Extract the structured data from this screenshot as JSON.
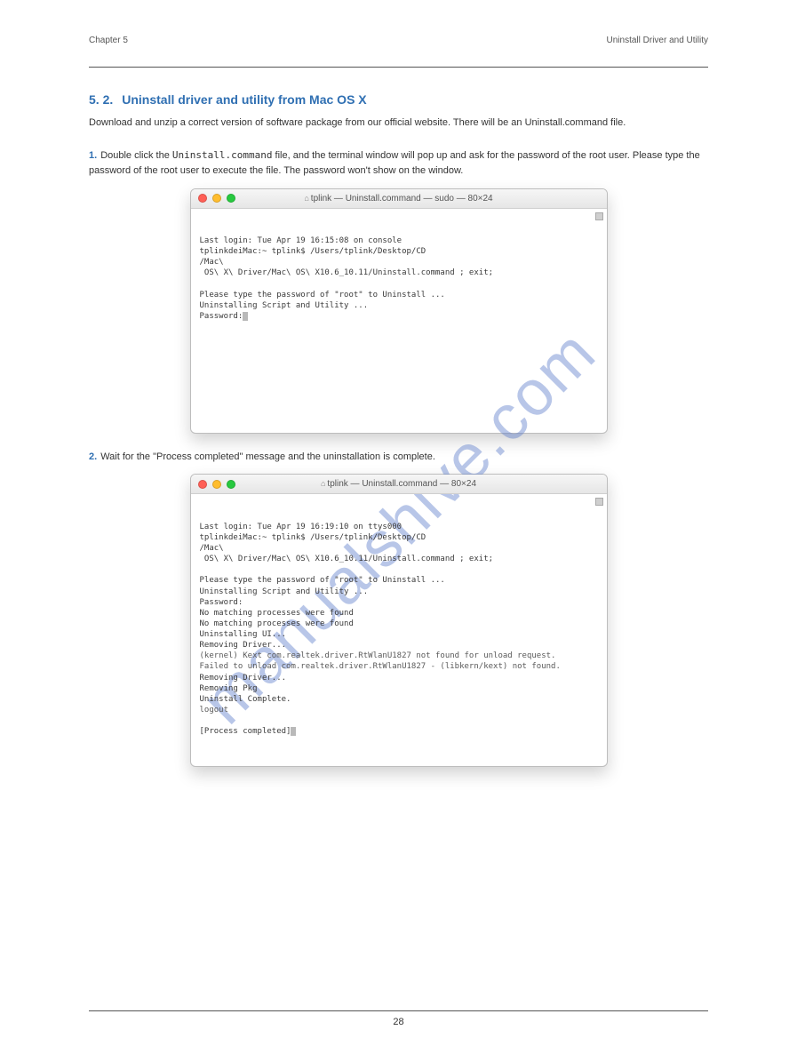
{
  "watermark": "manualshive.com",
  "header": {
    "chapter_num": "Chapter 5",
    "chapter_name": "Uninstall Driver and Utility",
    "section_num": "5. 2.",
    "section_name": "Uninstall driver and utility from Mac OS X",
    "intro": "Download and unzip a correct version of software package from our official website. There will be an Uninstall.command file.",
    "step1_num": "1.",
    "step1_a": "Double click the ",
    "step1_b": "Uninstall.command",
    "step1_c": " file, and the terminal window will pop up and ask for the password of the root user. Please type the password of the root user to execute the file. The password won't show on the window.",
    "step2_num": "2.",
    "step2_text": "Wait for the \"Process completed\" message and the uninstallation is complete."
  },
  "terminal1": {
    "title": "tplink — Uninstall.command — sudo — 80×24",
    "line1": "Last login: Tue Apr 19 16:15:08 on console",
    "line2a": "tplinkdeiMac:~ tplink$ /Users/tplink/Desktop/CD",
    "line2b": "/Mac\\",
    "line3": " OS\\ X\\ Driver/Mac\\ OS\\ X10.6_10.11/Uninstall.command ; exit;",
    "line4": "Please type the password of \"root\" to Uninstall ...",
    "line5": "Uninstalling Script and Utility ...",
    "line6": "Password:"
  },
  "terminal2": {
    "title": "tplink — Uninstall.command — 80×24",
    "line1": "Last login: Tue Apr 19 16:19:10 on ttys000",
    "line2a": "tplinkdeiMac:~ tplink$ /Users/tplink/Desktop/CD",
    "line2b": "/Mac\\",
    "line3": " OS\\ X\\ Driver/Mac\\ OS\\ X10.6_10.11/Uninstall.command ; exit;",
    "line4": "Please type the password of \"root\" to Uninstall ...",
    "line5": "Uninstalling Script and Utility ...",
    "line6": "Password:",
    "line7": "No matching processes were found",
    "line8": "No matching processes were found",
    "line9": "Uninstalling UI...",
    "line10": "Removing Driver...",
    "line11": "(kernel) Kext com.realtek.driver.RtWlanU1827 not found for unload request.",
    "line12": "Failed to unload com.realtek.driver.RtWlanU1827 - (libkern/kext) not found.",
    "line13": "Removing Driver...",
    "line14": "Removing Pkg",
    "line15": "Uninstall Complete.",
    "line16": "logout",
    "line17": "[Process completed]"
  },
  "footer": {
    "page": "28"
  }
}
